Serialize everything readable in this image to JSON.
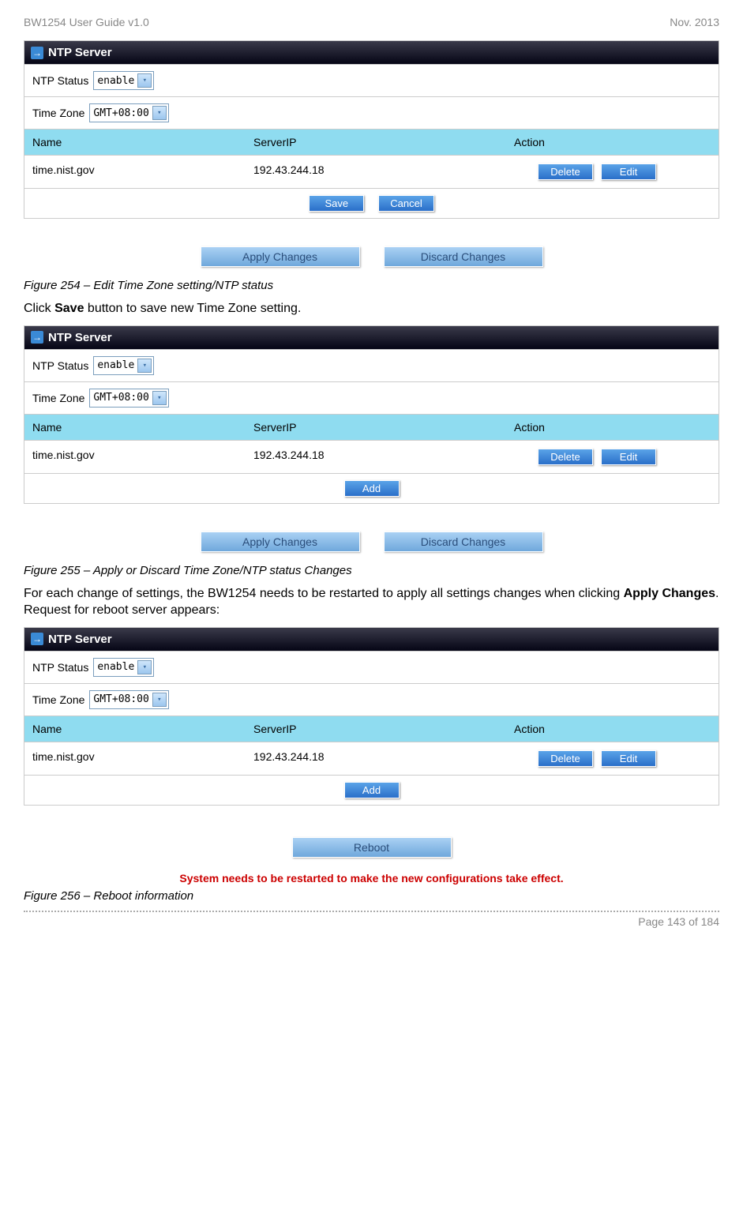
{
  "header": {
    "left": "BW1254 User Guide v1.0",
    "right": "Nov.  2013"
  },
  "panel": {
    "title": "NTP Server",
    "ntp_status_label": "NTP Status",
    "ntp_status_value": "enable",
    "time_zone_label": "Time Zone",
    "time_zone_value": "GMT+08:00",
    "columns": {
      "name": "Name",
      "ip": "ServerIP",
      "action": "Action"
    },
    "row": {
      "name": "time.nist.gov",
      "ip": "192.43.244.18"
    }
  },
  "buttons": {
    "delete": "Delete",
    "edit": "Edit",
    "save": "Save",
    "cancel": "Cancel",
    "add": "Add",
    "apply": "Apply Changes",
    "discard": "Discard Changes",
    "reboot": "Reboot"
  },
  "captions": {
    "fig254": "Figure 254 – Edit Time Zone setting/NTP status",
    "fig255": "Figure 255 – Apply or Discard Time Zone/NTP status Changes",
    "fig256": "Figure 256 – Reboot information"
  },
  "body": {
    "p1_a": "Click ",
    "p1_b": "Save",
    "p1_c": " button to save new Time Zone setting.",
    "p2_a": "For each change of settings, the BW1254 needs to be restarted to apply all settings changes when clicking ",
    "p2_b": "Apply Changes",
    "p2_c": ". Request for reboot server appears:"
  },
  "warning": "System needs to be restarted to make the new configurations take effect.",
  "footer": "Page 143 of 184"
}
